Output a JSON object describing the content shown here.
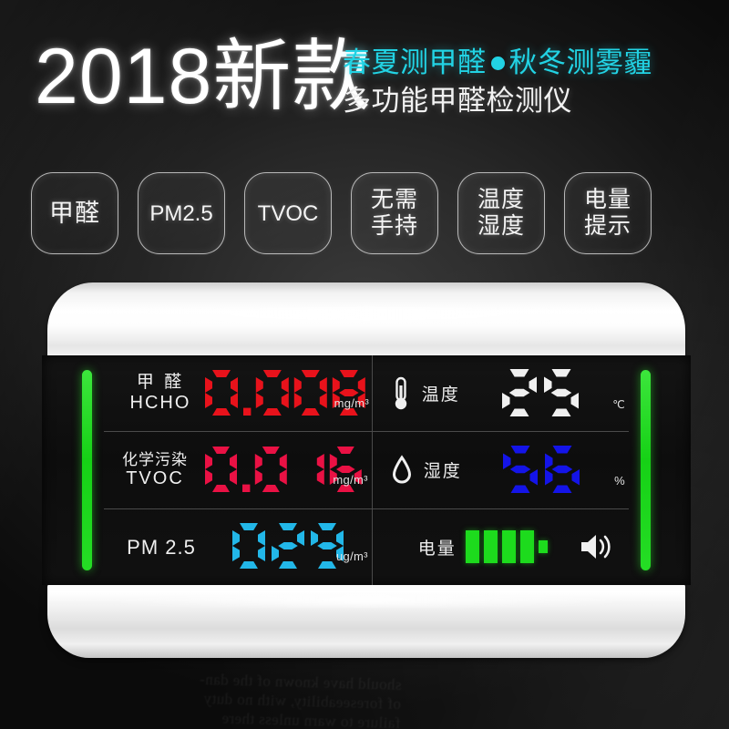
{
  "poster": {
    "headline_main": "2018新款",
    "tagline_part1": "春夏测甲醛",
    "tagline_bullet": "●",
    "tagline_part2": "秋冬测雾霾",
    "subtitle": "多功能甲醛检测仪",
    "ghost_text": "should have known of the dan-\nof foreseeability, with no duty\nfailure to warn unless there"
  },
  "badges": [
    {
      "line1": "甲醛",
      "line2": "",
      "style": "single"
    },
    {
      "line1": "PM2.5",
      "line2": "",
      "style": "wide"
    },
    {
      "line1": "TVOC",
      "line2": "",
      "style": "wide"
    },
    {
      "line1": "无需",
      "line2": "手持",
      "style": "double"
    },
    {
      "line1": "温度",
      "line2": "湿度",
      "style": "double"
    },
    {
      "line1": "电量",
      "line2": "提示",
      "style": "double"
    }
  ],
  "device": {
    "readings": {
      "hcho": {
        "label_cn": "甲 醛",
        "label_en": "HCHO",
        "value": "0.008",
        "unit": "mg/m³",
        "color": "#e8121b"
      },
      "tvoc": {
        "label_cn": "化学污染",
        "label_en": "TVOC",
        "value": "0.016",
        "unit": "mg/m³",
        "color": "#ea1144"
      },
      "pm25": {
        "label_cn": "",
        "label_en": "PM 2.5",
        "value": "029",
        "unit": "ug/m³",
        "color": "#22b7e8"
      },
      "temperature": {
        "label_cn": "温度",
        "value": "25",
        "unit": "℃",
        "color": "#f0f0f0",
        "icon": "thermometer-icon"
      },
      "humidity": {
        "label_cn": "湿度",
        "value": "56",
        "unit": "%",
        "color": "#1414e8",
        "icon": "water-drop-icon"
      },
      "battery": {
        "label_cn": "电量",
        "cells_filled": 4,
        "icon": "speaker-icon",
        "color": "#1ddb1d"
      }
    },
    "edge_indicator_color": "#1fd91f"
  },
  "colors": {
    "accent_cyan": "#22d3e4",
    "green": "#1fd91f",
    "background": "#151515"
  }
}
